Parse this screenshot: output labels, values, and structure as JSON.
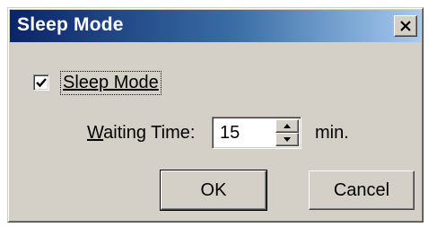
{
  "dialog": {
    "title": "Sleep Mode",
    "checkbox": {
      "label": "Sleep Mode",
      "checked": true
    },
    "waiting_time": {
      "label_accel": "W",
      "label_rest": "aiting Time:",
      "value": "15",
      "unit": "min."
    },
    "buttons": {
      "ok": "OK",
      "cancel": "Cancel"
    }
  },
  "colors": {
    "face": "#d4d0c8",
    "title_start": "#0a246a",
    "title_end": "#a6caf0"
  }
}
